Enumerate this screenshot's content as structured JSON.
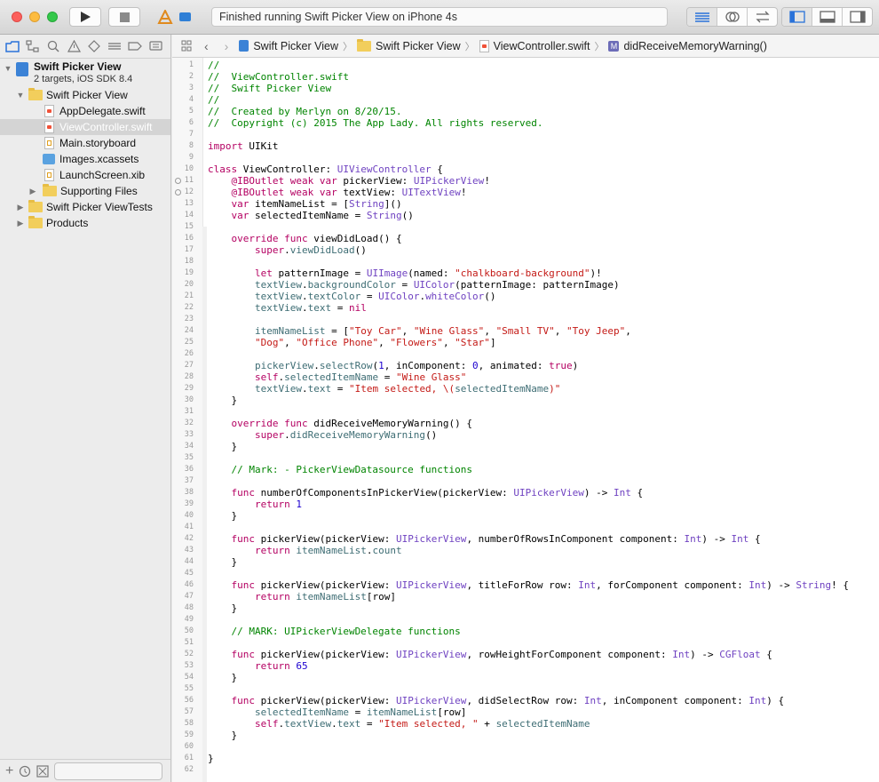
{
  "window": {
    "status": "Finished running Swift Picker View on iPhone 4s"
  },
  "jumpbar": {
    "project": "Swift Picker View",
    "group": "Swift Picker View",
    "file": "ViewController.swift",
    "symbol": "didReceiveMemoryWarning()"
  },
  "navigator": {
    "project_name": "Swift Picker View",
    "project_sub": "2 targets, iOS SDK 8.4",
    "items": [
      {
        "label": "Swift Picker View",
        "kind": "folder"
      },
      {
        "label": "AppDelegate.swift",
        "kind": "swift"
      },
      {
        "label": "ViewController.swift",
        "kind": "swift",
        "selected": true
      },
      {
        "label": "Main.storyboard",
        "kind": "storyboard"
      },
      {
        "label": "Images.xcassets",
        "kind": "assets"
      },
      {
        "label": "LaunchScreen.xib",
        "kind": "xib"
      },
      {
        "label": "Supporting Files",
        "kind": "folder"
      },
      {
        "label": "Swift Picker ViewTests",
        "kind": "folder"
      },
      {
        "label": "Products",
        "kind": "folder"
      }
    ]
  },
  "colors": {
    "comment": "#008400",
    "keyword": "#b40062",
    "type": "#6f42c1",
    "member": "#3e6d74",
    "string": "#c41a16",
    "number": "#1c00cf",
    "attribute": "#814b2c"
  },
  "code_lines": [
    [
      [
        "//",
        "comment"
      ]
    ],
    [
      [
        "//  ViewController.swift",
        "comment"
      ]
    ],
    [
      [
        "//  Swift Picker View",
        "comment"
      ]
    ],
    [
      [
        "//",
        "comment"
      ]
    ],
    [
      [
        "//  Created by Merlyn on 8/20/15.",
        "comment"
      ]
    ],
    [
      [
        "//  Copyright (c) 2015 The App Lady. All rights reserved.",
        "comment"
      ]
    ],
    [],
    [
      [
        "import",
        "keyword"
      ],
      [
        " UIKit",
        ""
      ]
    ],
    [],
    [
      [
        "class",
        "keyword"
      ],
      [
        " ViewController: ",
        ""
      ],
      [
        "UIViewController",
        "type"
      ],
      [
        " {",
        ""
      ]
    ],
    [
      [
        "    ",
        ""
      ],
      [
        "@IBOutlet",
        "keyword"
      ],
      [
        " ",
        ""
      ],
      [
        "weak",
        "keyword"
      ],
      [
        " ",
        ""
      ],
      [
        "var",
        "keyword"
      ],
      [
        " pickerView: ",
        ""
      ],
      [
        "UIPickerView",
        "type"
      ],
      [
        "!",
        ""
      ]
    ],
    [
      [
        "    ",
        ""
      ],
      [
        "@IBOutlet",
        "keyword"
      ],
      [
        " ",
        ""
      ],
      [
        "weak",
        "keyword"
      ],
      [
        " ",
        ""
      ],
      [
        "var",
        "keyword"
      ],
      [
        " textView: ",
        ""
      ],
      [
        "UITextView",
        "type"
      ],
      [
        "!",
        ""
      ]
    ],
    [
      [
        "    ",
        ""
      ],
      [
        "var",
        "keyword"
      ],
      [
        " itemNameList = [",
        ""
      ],
      [
        "String",
        "type"
      ],
      [
        "]()",
        ""
      ]
    ],
    [
      [
        "    ",
        ""
      ],
      [
        "var",
        "keyword"
      ],
      [
        " selectedItemName = ",
        ""
      ],
      [
        "String",
        "type"
      ],
      [
        "()",
        ""
      ]
    ],
    [],
    [
      [
        "    ",
        ""
      ],
      [
        "override",
        "keyword"
      ],
      [
        " ",
        ""
      ],
      [
        "func",
        "keyword"
      ],
      [
        " viewDidLoad() {",
        ""
      ]
    ],
    [
      [
        "        ",
        ""
      ],
      [
        "super",
        "keyword"
      ],
      [
        ".",
        ""
      ],
      [
        "viewDidLoad",
        "member"
      ],
      [
        "()",
        ""
      ]
    ],
    [],
    [
      [
        "        ",
        ""
      ],
      [
        "let",
        "keyword"
      ],
      [
        " patternImage = ",
        ""
      ],
      [
        "UIImage",
        "type"
      ],
      [
        "(named: ",
        ""
      ],
      [
        "\"chalkboard-background\"",
        "string"
      ],
      [
        ")!",
        ""
      ]
    ],
    [
      [
        "        ",
        ""
      ],
      [
        "textView",
        "member"
      ],
      [
        ".",
        ""
      ],
      [
        "backgroundColor",
        "member"
      ],
      [
        " = ",
        ""
      ],
      [
        "UIColor",
        "type"
      ],
      [
        "(patternImage: patternImage)",
        ""
      ]
    ],
    [
      [
        "        ",
        ""
      ],
      [
        "textView",
        "member"
      ],
      [
        ".",
        ""
      ],
      [
        "textColor",
        "member"
      ],
      [
        " = ",
        ""
      ],
      [
        "UIColor",
        "type"
      ],
      [
        ".",
        ""
      ],
      [
        "whiteColor",
        "type"
      ],
      [
        "()",
        ""
      ]
    ],
    [
      [
        "        ",
        ""
      ],
      [
        "textView",
        "member"
      ],
      [
        ".",
        ""
      ],
      [
        "text",
        "member"
      ],
      [
        " = ",
        ""
      ],
      [
        "nil",
        "keyword"
      ]
    ],
    [],
    [
      [
        "        ",
        ""
      ],
      [
        "itemNameList",
        "member"
      ],
      [
        " = [",
        ""
      ],
      [
        "\"Toy Car\"",
        "string"
      ],
      [
        ", ",
        ""
      ],
      [
        "\"Wine Glass\"",
        "string"
      ],
      [
        ", ",
        ""
      ],
      [
        "\"Small TV\"",
        "string"
      ],
      [
        ", ",
        ""
      ],
      [
        "\"Toy Jeep\"",
        "string"
      ],
      [
        ",",
        ""
      ]
    ],
    [
      [
        "        ",
        ""
      ],
      [
        "\"Dog\"",
        "string"
      ],
      [
        ", ",
        ""
      ],
      [
        "\"Office Phone\"",
        "string"
      ],
      [
        ", ",
        ""
      ],
      [
        "\"Flowers\"",
        "string"
      ],
      [
        ", ",
        ""
      ],
      [
        "\"Star\"",
        "string"
      ],
      [
        "]",
        ""
      ]
    ],
    [],
    [
      [
        "        ",
        ""
      ],
      [
        "pickerView",
        "member"
      ],
      [
        ".",
        ""
      ],
      [
        "selectRow",
        "member"
      ],
      [
        "(",
        ""
      ],
      [
        "1",
        "number"
      ],
      [
        ", inComponent: ",
        ""
      ],
      [
        "0",
        "number"
      ],
      [
        ", animated: ",
        ""
      ],
      [
        "true",
        "keyword"
      ],
      [
        ")",
        ""
      ]
    ],
    [
      [
        "        ",
        ""
      ],
      [
        "self",
        "keyword"
      ],
      [
        ".",
        ""
      ],
      [
        "selectedItemName",
        "member"
      ],
      [
        " = ",
        ""
      ],
      [
        "\"Wine Glass\"",
        "string"
      ]
    ],
    [
      [
        "        ",
        ""
      ],
      [
        "textView",
        "member"
      ],
      [
        ".",
        ""
      ],
      [
        "text",
        "member"
      ],
      [
        " = ",
        ""
      ],
      [
        "\"Item selected, \\(",
        "string"
      ],
      [
        "selectedItemName",
        "member"
      ],
      [
        ")\"",
        "string"
      ]
    ],
    [
      [
        "    }",
        ""
      ]
    ],
    [],
    [
      [
        "    ",
        ""
      ],
      [
        "override",
        "keyword"
      ],
      [
        " ",
        ""
      ],
      [
        "func",
        "keyword"
      ],
      [
        " didReceiveMemoryWarning() {",
        ""
      ]
    ],
    [
      [
        "        ",
        ""
      ],
      [
        "super",
        "keyword"
      ],
      [
        ".",
        ""
      ],
      [
        "didReceiveMemoryWarning",
        "member"
      ],
      [
        "()",
        ""
      ]
    ],
    [
      [
        "    }",
        ""
      ]
    ],
    [],
    [
      [
        "    // Mark: - PickerViewDatasource functions",
        "comment"
      ]
    ],
    [],
    [
      [
        "    ",
        ""
      ],
      [
        "func",
        "keyword"
      ],
      [
        " numberOfComponentsInPickerView(pickerView: ",
        ""
      ],
      [
        "UIPickerView",
        "type"
      ],
      [
        ") -> ",
        ""
      ],
      [
        "Int",
        "type"
      ],
      [
        " {",
        ""
      ]
    ],
    [
      [
        "        ",
        ""
      ],
      [
        "return",
        "keyword"
      ],
      [
        " ",
        ""
      ],
      [
        "1",
        "number"
      ]
    ],
    [
      [
        "    }",
        ""
      ]
    ],
    [],
    [
      [
        "    ",
        ""
      ],
      [
        "func",
        "keyword"
      ],
      [
        " pickerView(pickerView: ",
        ""
      ],
      [
        "UIPickerView",
        "type"
      ],
      [
        ", numberOfRowsInComponent component: ",
        ""
      ],
      [
        "Int",
        "type"
      ],
      [
        ") -> ",
        ""
      ],
      [
        "Int",
        "type"
      ],
      [
        " {",
        ""
      ]
    ],
    [
      [
        "        ",
        ""
      ],
      [
        "return",
        "keyword"
      ],
      [
        " ",
        ""
      ],
      [
        "itemNameList",
        "member"
      ],
      [
        ".",
        ""
      ],
      [
        "count",
        "member"
      ]
    ],
    [
      [
        "    }",
        ""
      ]
    ],
    [],
    [
      [
        "    ",
        ""
      ],
      [
        "func",
        "keyword"
      ],
      [
        " pickerView(pickerView: ",
        ""
      ],
      [
        "UIPickerView",
        "type"
      ],
      [
        ", titleForRow row: ",
        ""
      ],
      [
        "Int",
        "type"
      ],
      [
        ", forComponent component: ",
        ""
      ],
      [
        "Int",
        "type"
      ],
      [
        ") -> ",
        ""
      ],
      [
        "String",
        "type"
      ],
      [
        "! {",
        ""
      ]
    ],
    [
      [
        "        ",
        ""
      ],
      [
        "return",
        "keyword"
      ],
      [
        " ",
        ""
      ],
      [
        "itemNameList",
        "member"
      ],
      [
        "[row]",
        ""
      ]
    ],
    [
      [
        "    }",
        ""
      ]
    ],
    [],
    [
      [
        "    // MARK: UIPickerViewDelegate functions",
        "comment"
      ]
    ],
    [],
    [
      [
        "    ",
        ""
      ],
      [
        "func",
        "keyword"
      ],
      [
        " pickerView(pickerView: ",
        ""
      ],
      [
        "UIPickerView",
        "type"
      ],
      [
        ", rowHeightForComponent component: ",
        ""
      ],
      [
        "Int",
        "type"
      ],
      [
        ") -> ",
        ""
      ],
      [
        "CGFloat",
        "type"
      ],
      [
        " {",
        ""
      ]
    ],
    [
      [
        "        ",
        ""
      ],
      [
        "return",
        "keyword"
      ],
      [
        " ",
        ""
      ],
      [
        "65",
        "number"
      ]
    ],
    [
      [
        "    }",
        ""
      ]
    ],
    [],
    [
      [
        "    ",
        ""
      ],
      [
        "func",
        "keyword"
      ],
      [
        " pickerView(pickerView: ",
        ""
      ],
      [
        "UIPickerView",
        "type"
      ],
      [
        ", didSelectRow row: ",
        ""
      ],
      [
        "Int",
        "type"
      ],
      [
        ", inComponent component: ",
        ""
      ],
      [
        "Int",
        "type"
      ],
      [
        ") {",
        ""
      ]
    ],
    [
      [
        "        ",
        ""
      ],
      [
        "selectedItemName",
        "member"
      ],
      [
        " = ",
        ""
      ],
      [
        "itemNameList",
        "member"
      ],
      [
        "[row]",
        ""
      ]
    ],
    [
      [
        "        ",
        ""
      ],
      [
        "self",
        "keyword"
      ],
      [
        ".",
        ""
      ],
      [
        "textView",
        "member"
      ],
      [
        ".",
        ""
      ],
      [
        "text",
        "member"
      ],
      [
        " = ",
        ""
      ],
      [
        "\"Item selected, \"",
        "string"
      ],
      [
        " + ",
        ""
      ],
      [
        "selectedItemName",
        "member"
      ]
    ],
    [
      [
        "    }",
        ""
      ]
    ],
    [],
    [
      [
        "}",
        ""
      ]
    ],
    []
  ],
  "outlet_lines": [
    11,
    12
  ]
}
